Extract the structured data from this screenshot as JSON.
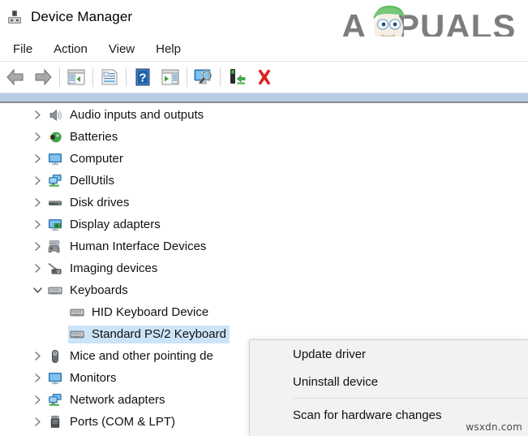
{
  "window": {
    "title": "Device Manager",
    "title_icon": "device-manager-icon"
  },
  "branding": {
    "logo_text": "APPUALS",
    "logo_accent": "#7d7d7d",
    "logo_hat_color": "#5cb85c",
    "watermark": "wsxdn.com"
  },
  "menubar": {
    "items": [
      {
        "label": "File",
        "name": "menu-file"
      },
      {
        "label": "Action",
        "name": "menu-action"
      },
      {
        "label": "View",
        "name": "menu-view"
      },
      {
        "label": "Help",
        "name": "menu-help"
      }
    ]
  },
  "toolbar": {
    "buttons": [
      {
        "name": "back-button",
        "icon": "back-arrow-icon",
        "title": "Back"
      },
      {
        "name": "forward-button",
        "icon": "forward-arrow-icon",
        "title": "Forward"
      },
      {
        "name": "show-hide-console-tree-button",
        "icon": "console-tree-icon",
        "title": "Show/Hide Console Tree"
      },
      {
        "name": "properties-button",
        "icon": "properties-icon",
        "title": "Properties"
      },
      {
        "name": "help-button",
        "icon": "help-question-icon",
        "title": "Help"
      },
      {
        "name": "update-driver-toolbar-button",
        "icon": "update-driver-icon",
        "title": "Update Driver Software"
      },
      {
        "name": "scan-hardware-changes-button",
        "icon": "scan-monitor-icon",
        "title": "Scan for hardware changes"
      },
      {
        "name": "enable-device-button",
        "icon": "enable-device-icon",
        "title": "Enable device"
      },
      {
        "name": "uninstall-device-button",
        "icon": "red-x-icon",
        "title": "Uninstall device"
      }
    ]
  },
  "tree": {
    "items": [
      {
        "label": "Audio inputs and outputs",
        "icon": "speaker-icon",
        "level": 0,
        "expanded": false,
        "expandable": true,
        "selected": false
      },
      {
        "label": "Batteries",
        "icon": "battery-plug-icon",
        "level": 0,
        "expanded": false,
        "expandable": true,
        "selected": false
      },
      {
        "label": "Computer",
        "icon": "monitor-icon",
        "level": 0,
        "expanded": false,
        "expandable": true,
        "selected": false
      },
      {
        "label": "DellUtils",
        "icon": "network-stack-icon",
        "level": 0,
        "expanded": false,
        "expandable": true,
        "selected": false
      },
      {
        "label": "Disk drives",
        "icon": "disk-drive-icon",
        "level": 0,
        "expanded": false,
        "expandable": true,
        "selected": false
      },
      {
        "label": "Display adapters",
        "icon": "display-adapter-icon",
        "level": 0,
        "expanded": false,
        "expandable": true,
        "selected": false
      },
      {
        "label": "Human Interface Devices",
        "icon": "gamepad-icon",
        "level": 0,
        "expanded": false,
        "expandable": true,
        "selected": false
      },
      {
        "label": "Imaging devices",
        "icon": "camera-icon",
        "level": 0,
        "expanded": false,
        "expandable": true,
        "selected": false
      },
      {
        "label": "Keyboards",
        "icon": "keyboard-icon",
        "level": 0,
        "expanded": true,
        "expandable": true,
        "selected": false
      },
      {
        "label": "HID Keyboard Device",
        "icon": "keyboard-icon",
        "level": 1,
        "expanded": false,
        "expandable": false,
        "selected": false
      },
      {
        "label": "Standard PS/2 Keyboard",
        "icon": "keyboard-icon",
        "level": 1,
        "expanded": false,
        "expandable": false,
        "selected": true
      },
      {
        "label": "Mice and other pointing de",
        "icon": "mouse-icon",
        "level": 0,
        "expanded": false,
        "expandable": true,
        "selected": false
      },
      {
        "label": "Monitors",
        "icon": "monitor-icon",
        "level": 0,
        "expanded": false,
        "expandable": true,
        "selected": false
      },
      {
        "label": "Network adapters",
        "icon": "network-stack-icon",
        "level": 0,
        "expanded": false,
        "expandable": true,
        "selected": false
      },
      {
        "label": "Ports (COM & LPT)",
        "icon": "port-icon",
        "level": 0,
        "expanded": false,
        "expandable": true,
        "selected": false
      }
    ]
  },
  "context_menu": {
    "items": [
      {
        "label": "Update driver",
        "name": "ctx-update-driver",
        "type": "item"
      },
      {
        "label": "Uninstall device",
        "name": "ctx-uninstall-device",
        "type": "item"
      },
      {
        "label": "",
        "name": "ctx-separator",
        "type": "separator"
      },
      {
        "label": "Scan for hardware changes",
        "name": "ctx-scan-hardware-changes",
        "type": "item"
      }
    ]
  },
  "colors": {
    "selection": "#cce4f7",
    "band": "#b8cce4",
    "menu_bg": "#f2f2f2"
  }
}
